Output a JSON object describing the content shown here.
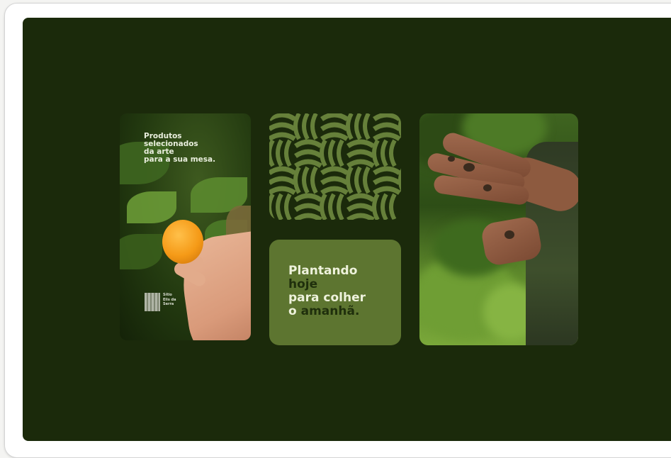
{
  "poster_left": {
    "tagline": "Produtos\nselecionados\nda arte\npara a sua mesa.",
    "logo_text": "Sítio\nElis da\nSerra"
  },
  "slogan": {
    "line1": "Plantando",
    "line2": "hoje",
    "line3": "para colher",
    "line4a": "o",
    "line4b": "amanhã."
  },
  "colors": {
    "background": "#1b2a0b",
    "tile_green": "#5d7530",
    "pattern_green": "#66803a",
    "orange": "#f59a17"
  }
}
